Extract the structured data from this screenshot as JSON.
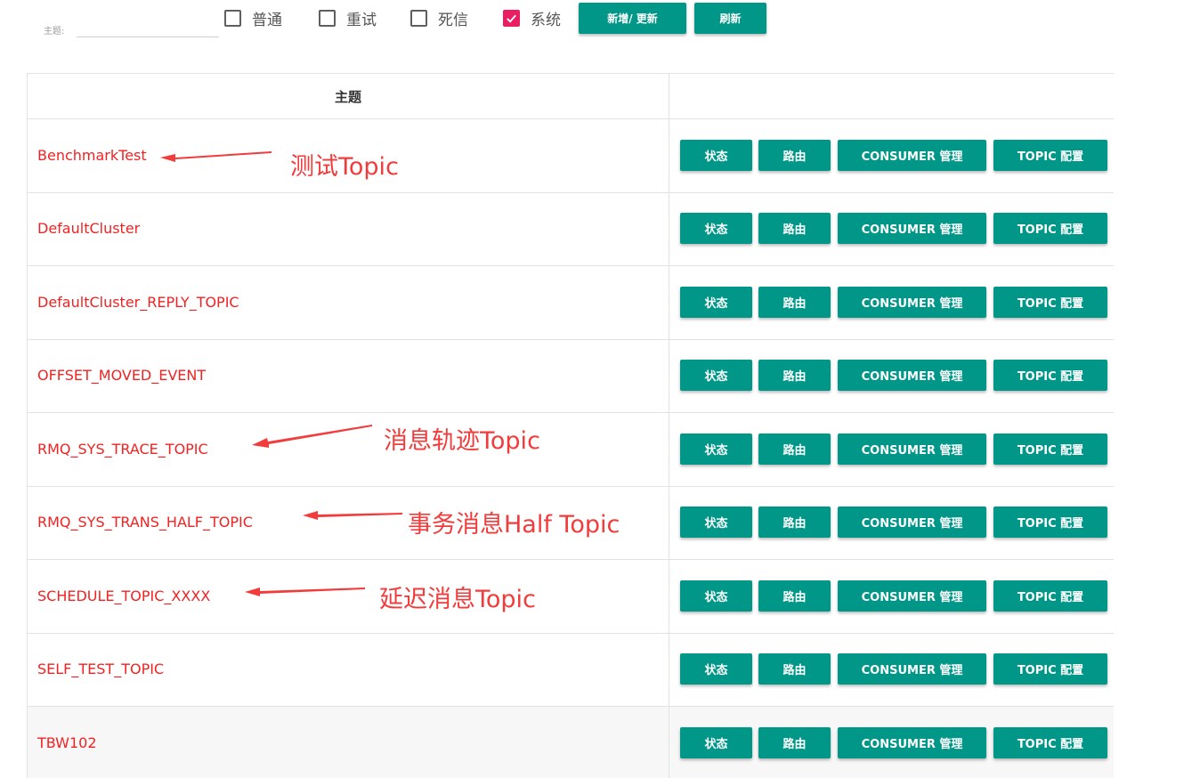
{
  "filter": {
    "topic_label": "主题:",
    "topic_value": "",
    "checkboxes": [
      {
        "label": "普通",
        "checked": false
      },
      {
        "label": "重试",
        "checked": false
      },
      {
        "label": "死信",
        "checked": false
      },
      {
        "label": "系统",
        "checked": true
      }
    ],
    "add_update_label": "新增/ 更新",
    "refresh_label": "刷新"
  },
  "table": {
    "col_topic_header": "主题",
    "col_ops_header": "",
    "op_labels": [
      "状态",
      "路由",
      "CONSUMER 管理",
      "TOPIC 配置"
    ],
    "rows": [
      {
        "topic": "BenchmarkTest"
      },
      {
        "topic": "DefaultCluster"
      },
      {
        "topic": "DefaultCluster_REPLY_TOPIC"
      },
      {
        "topic": "OFFSET_MOVED_EVENT"
      },
      {
        "topic": "RMQ_SYS_TRACE_TOPIC"
      },
      {
        "topic": "RMQ_SYS_TRANS_HALF_TOPIC"
      },
      {
        "topic": "SCHEDULE_TOPIC_XXXX"
      },
      {
        "topic": "SELF_TEST_TOPIC"
      },
      {
        "topic": "TBW102"
      }
    ]
  },
  "annotations": [
    {
      "text": "测试Topic"
    },
    {
      "text": "消息轨迹Topic"
    },
    {
      "text": "事务消息Half Topic"
    },
    {
      "text": "延迟消息Topic"
    }
  ],
  "colors": {
    "accent": "#009688",
    "checkbox_checked": "#e91e63",
    "topic_text": "#f32222",
    "annotation": "#f23b3b"
  }
}
